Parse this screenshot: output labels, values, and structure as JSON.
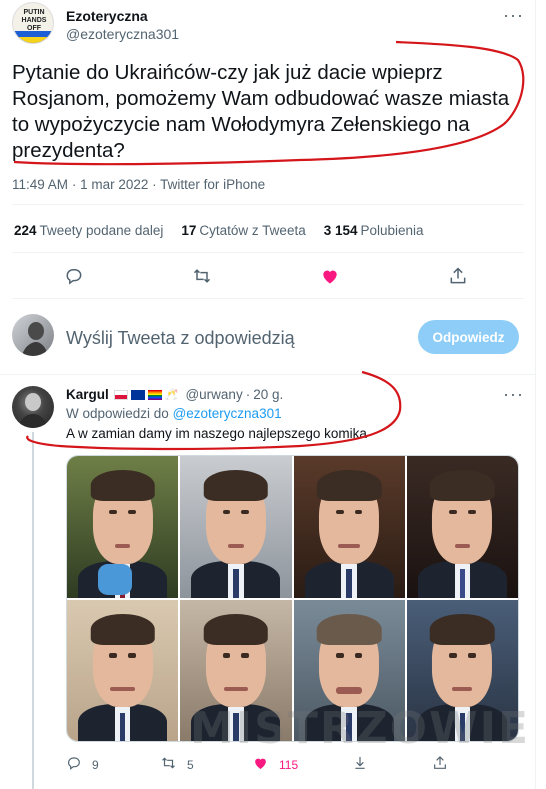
{
  "main_tweet": {
    "avatar_text": "PUTIN HANDS OFF UKRAINE!",
    "name": "Ezoteryczna",
    "handle": "@ezoteryczna301",
    "text_lines": [
      "Pytanie do Ukraińców-czy jak już dacie wpieprz",
      "Rosjanom, pomożemy Wam odbudować wasze miasta",
      "to wypożyczycie nam Wołodymyra Zełenskiego na",
      "prezydenta?"
    ],
    "time": "11:49 AM",
    "date": "1 mar 2022",
    "source": "Twitter for iPhone",
    "stats": {
      "retweets_count": "224",
      "retweets_label": "Tweety podane dalej",
      "quotes_count": "17",
      "quotes_label": "Cytatów z Tweeta",
      "likes_count": "3 154",
      "likes_label": "Polubienia"
    },
    "liked": true
  },
  "reply_box": {
    "placeholder": "Wyślij Tweeta z odpowiedzią",
    "button_label": "Odpowiedz"
  },
  "reply_tweet": {
    "name": "Kargul",
    "handle": "@urwany",
    "time": "20 g.",
    "replying_to_label": "W odpowiedzi do",
    "replying_to_handle": "@ezoteryczna301",
    "text": "A w zamian damy im naszego najlepszego komika",
    "counts": {
      "replies": "9",
      "retweets": "5",
      "likes": "115"
    }
  },
  "watermark": "MISTRZOWIE",
  "colors": {
    "accent": "#1d9bf0",
    "like": "#f91880",
    "annotation": "#d4161b",
    "button_disabled": "#8ecdf7"
  },
  "icons": [
    "more-icon",
    "reply-icon",
    "retweet-icon",
    "heart-icon",
    "share-icon"
  ]
}
